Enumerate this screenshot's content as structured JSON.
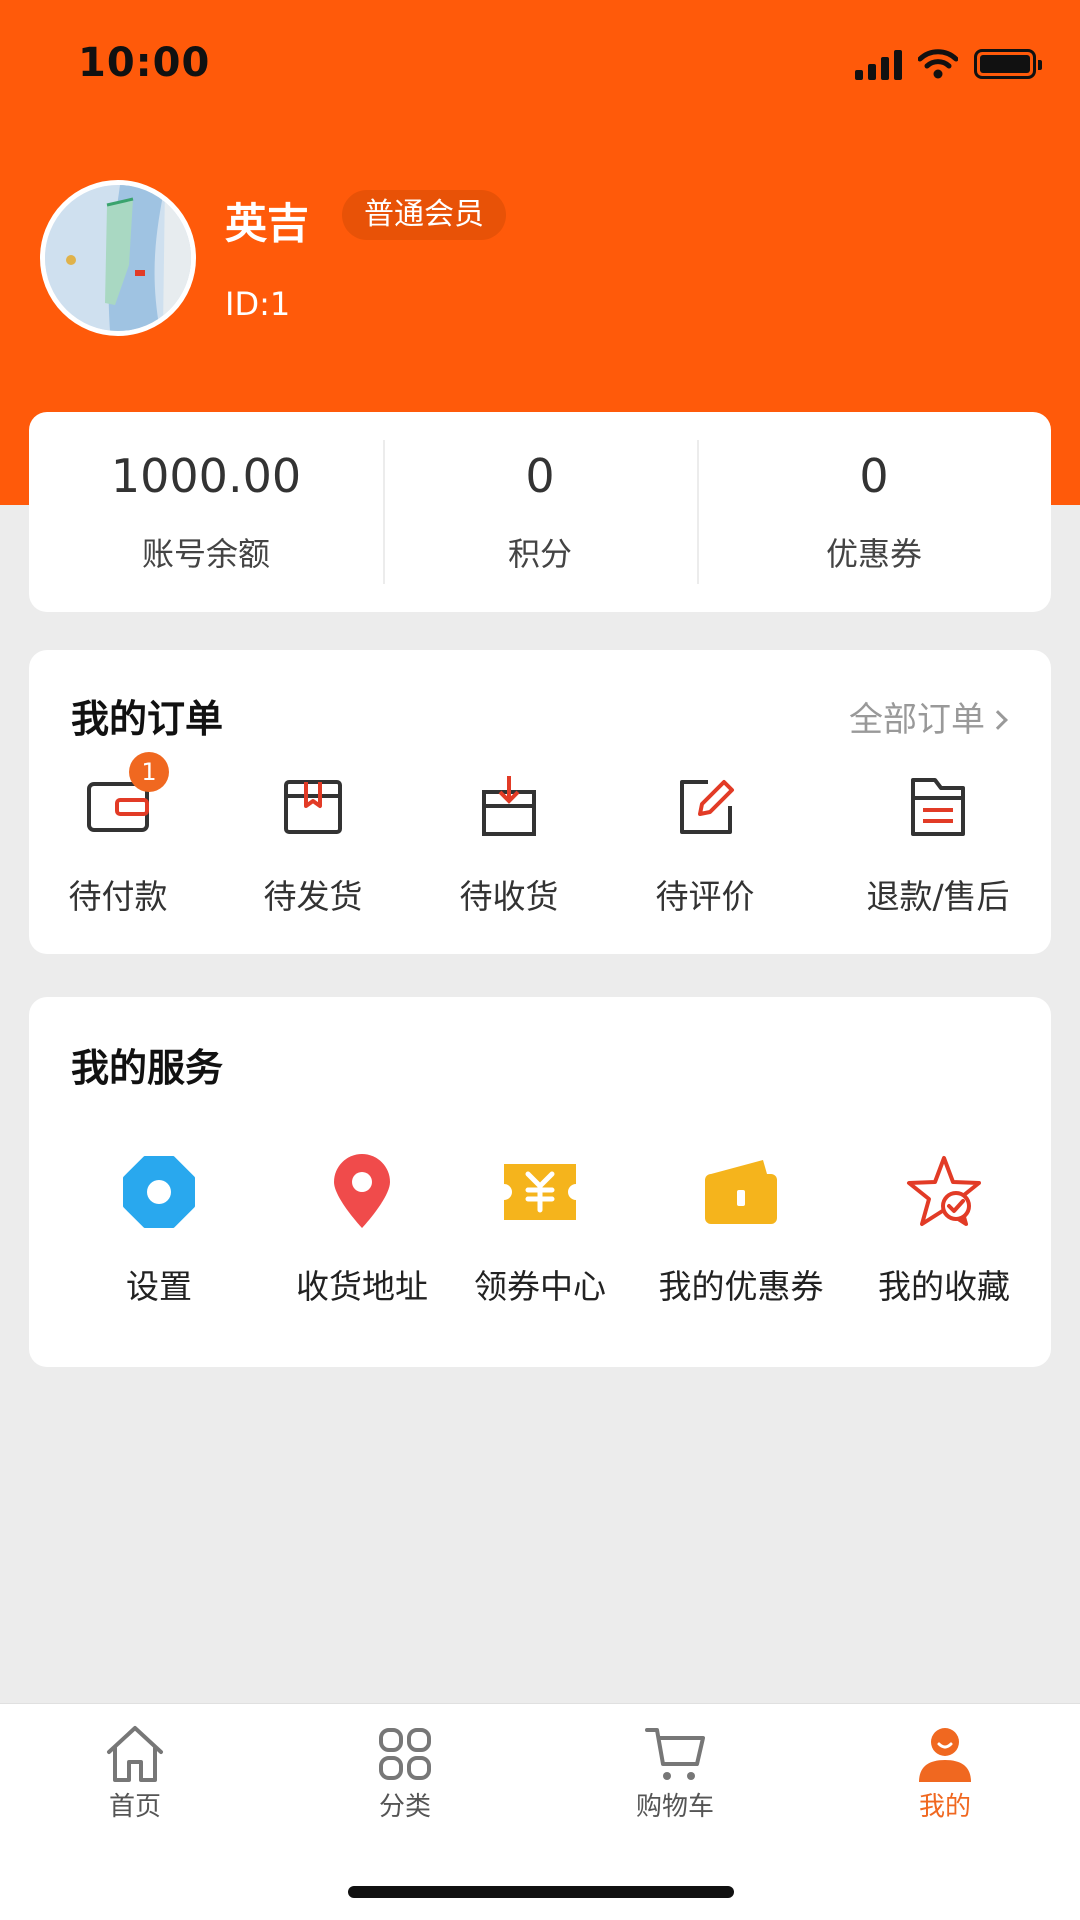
{
  "status_bar": {
    "time": "10:00"
  },
  "profile": {
    "name": "英吉",
    "member_level": "普通会员",
    "user_id": "ID:1"
  },
  "stats": [
    {
      "value": "1000.00",
      "label": "账号余额"
    },
    {
      "value": "0",
      "label": "积分"
    },
    {
      "value": "0",
      "label": "优惠券"
    }
  ],
  "orders": {
    "title": "我的订单",
    "view_all": "全部订单",
    "items": [
      {
        "label": "待付款",
        "icon": "wallet-icon",
        "badge": "1"
      },
      {
        "label": "待发货",
        "icon": "package-icon"
      },
      {
        "label": "待收货",
        "icon": "box-receive-icon"
      },
      {
        "label": "待评价",
        "icon": "edit-review-icon"
      },
      {
        "label": "退款/售后",
        "icon": "refund-folder-icon"
      }
    ]
  },
  "services": {
    "title": "我的服务",
    "items": [
      {
        "label": "设置",
        "icon": "settings-icon",
        "color": "#29a8ee"
      },
      {
        "label": "收货地址",
        "icon": "location-pin-icon",
        "color": "#f04b4b"
      },
      {
        "label": "领券中心",
        "icon": "coupon-center-icon",
        "color": "#f5b41c"
      },
      {
        "label": "我的优惠券",
        "icon": "wallet-coupon-icon",
        "color": "#f5b41c"
      },
      {
        "label": "我的收藏",
        "icon": "favorite-star-icon",
        "color": "#e23b26"
      }
    ]
  },
  "tab_bar": {
    "tabs": [
      {
        "label": "首页",
        "icon": "home-icon"
      },
      {
        "label": "分类",
        "icon": "category-grid-icon"
      },
      {
        "label": "购物车",
        "icon": "cart-icon"
      },
      {
        "label": "我的",
        "icon": "profile-icon",
        "active": true
      }
    ]
  },
  "colors": {
    "brand": "#ff5a0a",
    "badge": "#f06820",
    "background": "#ececec"
  }
}
